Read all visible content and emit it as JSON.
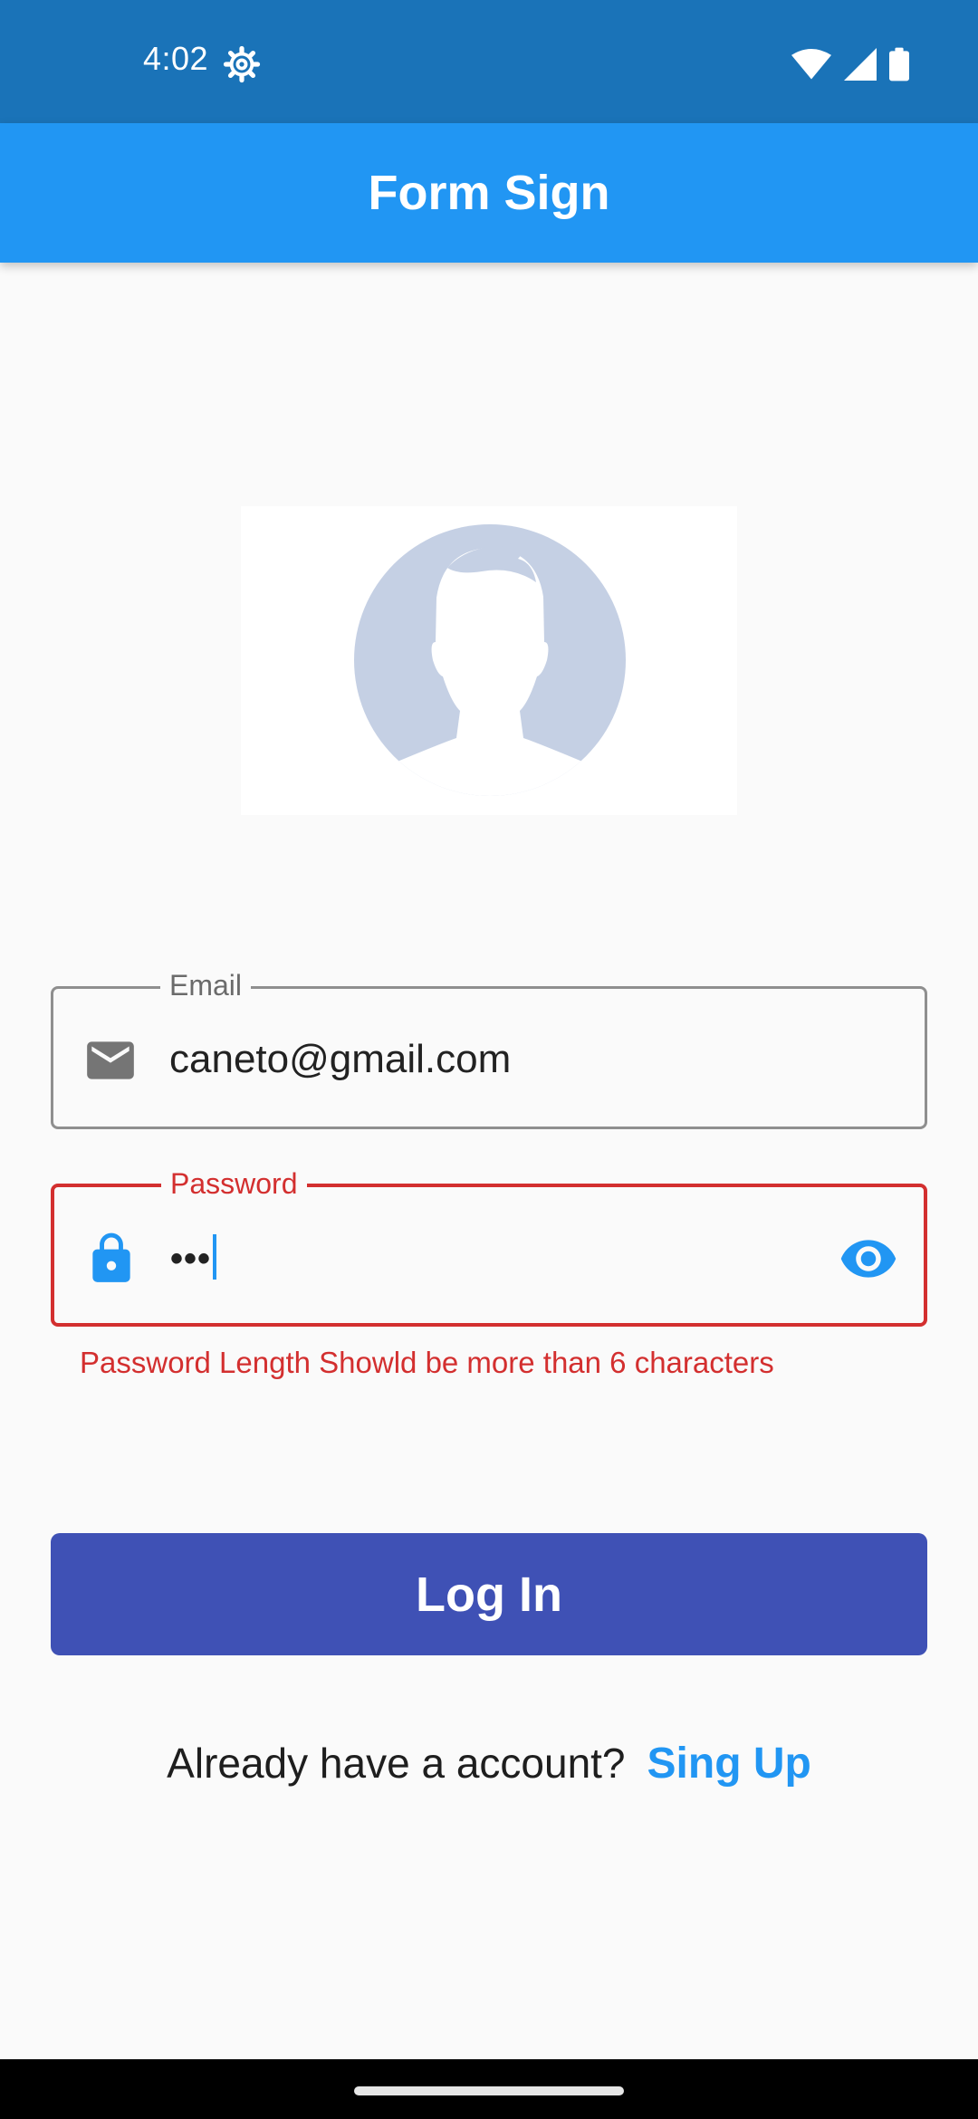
{
  "status_bar": {
    "time": "4:02",
    "icons": [
      "settings-gear-icon",
      "wifi-icon",
      "cell-signal-icon",
      "battery-icon"
    ]
  },
  "app_bar": {
    "title": "Form Sign",
    "color": "#2196f3"
  },
  "avatar": {
    "icon": "person-silhouette-icon"
  },
  "email_field": {
    "label": "Email",
    "value": "caneto@gmail.com",
    "icon": "mail-icon"
  },
  "password_field": {
    "label": "Password",
    "masked_value": "•••",
    "icon": "lock-icon",
    "toggle_icon": "eye-icon",
    "error": "Password Length Showld be more than 6 characters",
    "error_color": "#d32f2f"
  },
  "login_button": {
    "label": "Log In",
    "color": "#3f51b5"
  },
  "signup": {
    "prompt": "Already have a account?",
    "link": "Sing Up"
  }
}
